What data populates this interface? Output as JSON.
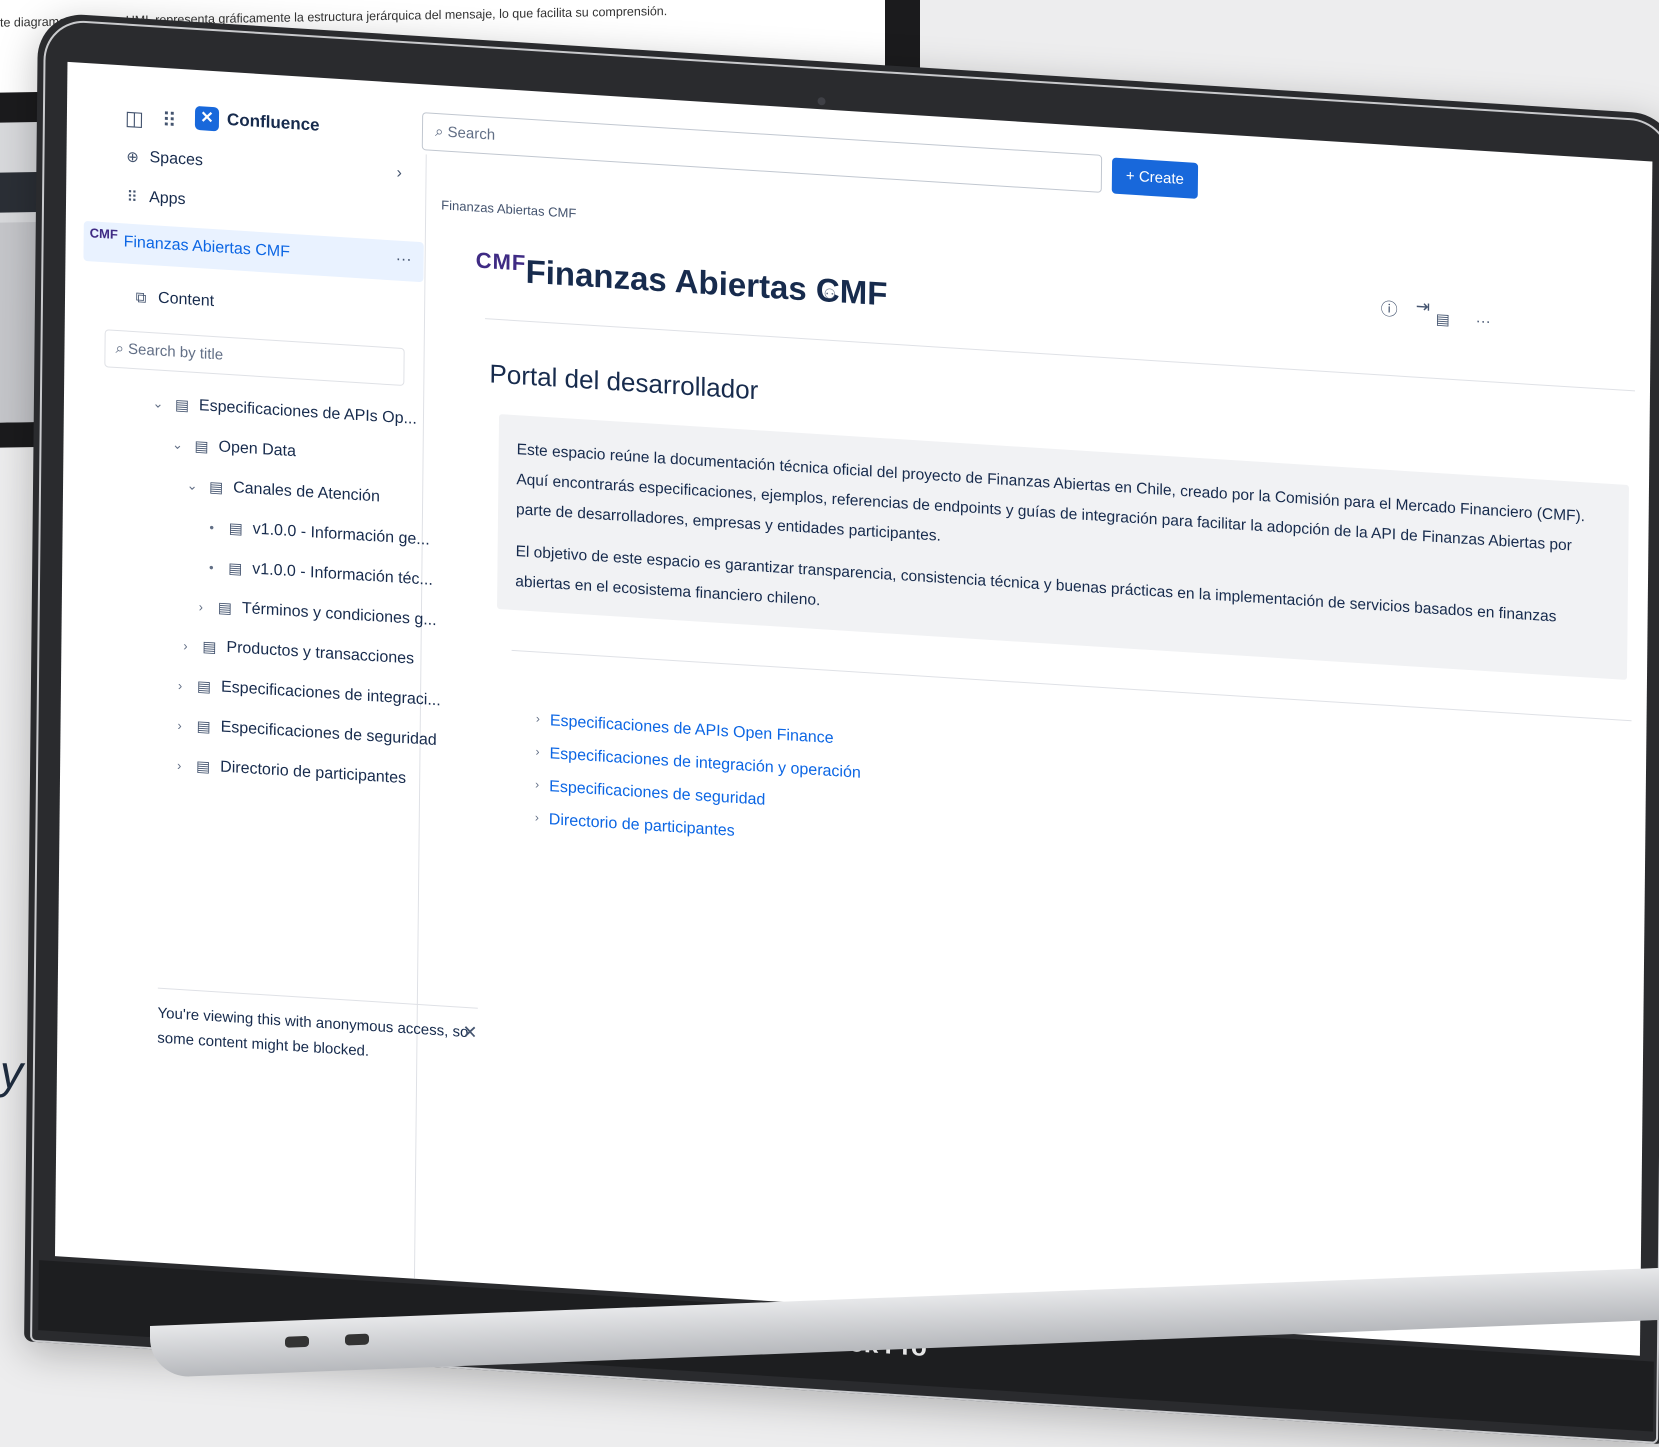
{
  "background": {
    "monitor_text": "te diagrama de clases UML representa gráficamente la estructura jerárquica del mensaje, lo que facilita su comprensión.",
    "mark": "y"
  },
  "laptop": {
    "brand": "MacBook Pro"
  },
  "top_nav": {
    "product": "Confluence",
    "search_placeholder": "Search",
    "create_label": "Create"
  },
  "sidebar": {
    "spaces_label": "Spaces",
    "apps_label": "Apps",
    "space_name": "Finanzas Abiertas CMF",
    "content_label": "Content",
    "search_placeholder": "Search by title",
    "tree": [
      {
        "label": "Especificaciones de APIs Op..."
      },
      {
        "label": "Open Data"
      },
      {
        "label": "Canales de Atención"
      },
      {
        "label": "v1.0.0 - Información ge..."
      },
      {
        "label": "v1.0.0 - Información téc..."
      },
      {
        "label": "Términos y condiciones g..."
      },
      {
        "label": "Productos y transacciones"
      },
      {
        "label": "Especificaciones de integraci..."
      },
      {
        "label": "Especificaciones de seguridad"
      },
      {
        "label": "Directorio de participantes"
      }
    ],
    "notice": "You're viewing this with anonymous access, so some content might be blocked."
  },
  "main": {
    "breadcrumb": "Finanzas Abiertas CMF",
    "logo_text": "CMF",
    "title": "Finanzas Abiertas CMF",
    "section_title": "Portal del desarrollador",
    "paragraph_1": "Este espacio reúne la documentación técnica oficial del proyecto de Finanzas Abiertas en Chile, creado por la Comisión para el Mercado Financiero (CMF). Aquí encontrarás especificaciones, ejemplos, referencias de endpoints y guías de integración para facilitar la adopción de la API de Finanzas Abiertas por parte de desarrolladores, empresas y entidades participantes.",
    "paragraph_2": "El objetivo de este espacio es garantizar transparencia, consistencia técnica y buenas prácticas en la implementación de servicios basados en finanzas abiertas en el ecosistema financiero chileno.",
    "links": [
      {
        "label": "Especificaciones de APIs Open Finance"
      },
      {
        "label": "Especificaciones de integración y operación"
      },
      {
        "label": "Especificaciones de seguridad"
      },
      {
        "label": "Directorio de participantes"
      }
    ]
  }
}
